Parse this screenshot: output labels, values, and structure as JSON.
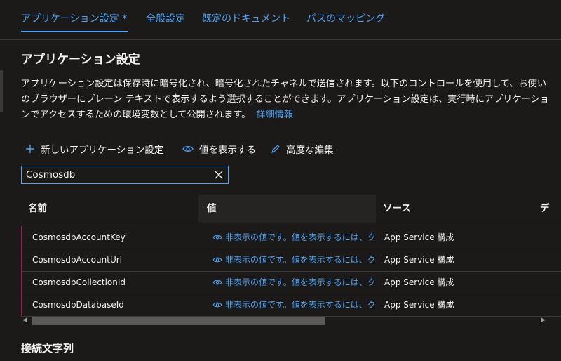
{
  "tabs": [
    {
      "label": "アプリケーション設定 *"
    },
    {
      "label": "全般設定"
    },
    {
      "label": "既定のドキュメント"
    },
    {
      "label": "パスのマッピング"
    }
  ],
  "section": {
    "title": "アプリケーション設定",
    "description": "アプリケーション設定は保存時に暗号化され、暗号化されたチャネルで送信されます。以下のコントロールを使用して、お使いのブラウザーにプレーン テキストで表示するよう選択することができます。アプリケーション設定は、実行時にアプリケーションでアクセスするための環境変数として公開されます。",
    "learn_more": "詳細情報"
  },
  "toolbar": {
    "new_label": "新しいアプリケーション設定",
    "show_values_label": "値を表示する",
    "advanced_edit_label": "高度な編集"
  },
  "filter": {
    "value": "Cosmosdb"
  },
  "table": {
    "headers": {
      "name": "名前",
      "value": "値",
      "source": "ソース",
      "extra": "デ"
    },
    "rows": [
      {
        "name": "CosmosdbAccountKey",
        "value": "非表示の値です。値を表示するには、ク",
        "source": "App Service 構成"
      },
      {
        "name": "CosmosdbAccountUrl",
        "value": "非表示の値です。値を表示するには、ク",
        "source": "App Service 構成"
      },
      {
        "name": "CosmosdbCollectionId",
        "value": "非表示の値です。値を表示するには、ク",
        "source": "App Service 構成"
      },
      {
        "name": "CosmosdbDatabaseId",
        "value": "非表示の値です。値を表示するには、ク",
        "source": "App Service 構成"
      }
    ]
  },
  "connection_strings": {
    "title": "接続文字列"
  },
  "icons": {
    "add": "plus-icon",
    "eye": "eye-icon",
    "edit": "pencil-icon",
    "clear": "close-icon"
  },
  "colors": {
    "accent": "#4ea1f3",
    "background": "#1b1a19",
    "row_marker": "#8a2a52"
  }
}
